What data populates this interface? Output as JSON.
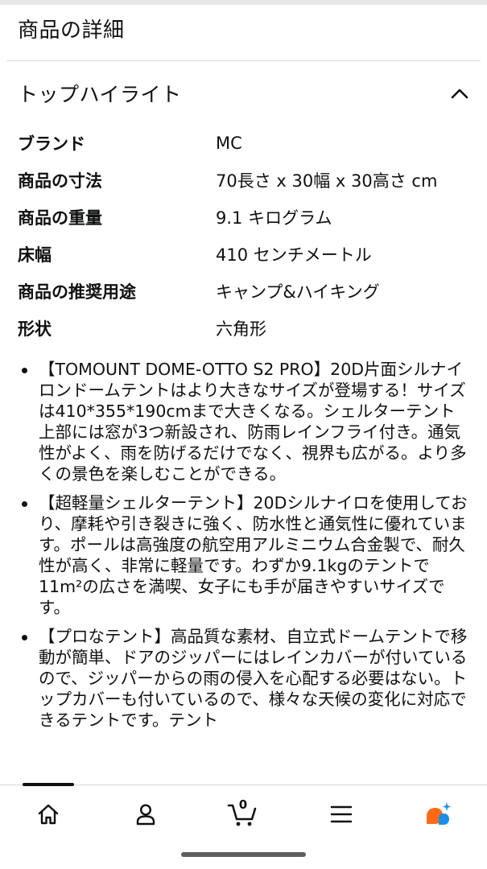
{
  "section": {
    "title": "商品の詳細"
  },
  "highlights": {
    "title": "トップハイライト",
    "specs": [
      {
        "key": "ブランド",
        "value": "MC"
      },
      {
        "key": "商品の寸法",
        "value": "70長さ x 30幅 x 30高さ cm"
      },
      {
        "key": "商品の重量",
        "value": "9.1 キログラム"
      },
      {
        "key": "床幅",
        "value": "410 センチメートル"
      },
      {
        "key": "商品の推奨用途",
        "value": "キャンプ&ハイキング"
      },
      {
        "key": "形状",
        "value": "六角形"
      }
    ]
  },
  "bullets": [
    "【TOMOUNT DOME-OTTO S2 PRO】20D片面シルナイロンドームテントはより大きなサイズが登場する！サイズは410*355*190cmまで大きくなる。シェルターテント上部には窓が3つ新設され、防雨レインフライ付き。通気性がよく、雨を防げるだけでなく、視界も広がる。より多くの景色を楽しむことができる。",
    "【超軽量シェルターテント】20Dシルナイロを使用しており、摩耗や引き裂きに強く、防水性と通気性に優れています。ポールは高強度の航空用アルミニウム合金製で、耐久性が高く、非常に軽量です。わずか9.1kgのテントで11m²の広さを満喫、女子にも手が届きやすいサイズです。",
    "【プロなテント】高品質な素材、自立式ドームテントで移動が簡単、ドアのジッパーにはレインカバーが付いているので、ジッパーからの雨の侵入を心配する必要はない。トップカバーも付いているので、様々な天候の変化に対応できるテントです。テント"
  ],
  "nav": {
    "cart_count": "0",
    "icons": [
      "home-icon",
      "account-icon",
      "cart-icon",
      "menu-icon",
      "assistant-icon"
    ]
  },
  "colors": {
    "accent": "#ff6a13",
    "assistant_blue": "#1b8fe6"
  }
}
